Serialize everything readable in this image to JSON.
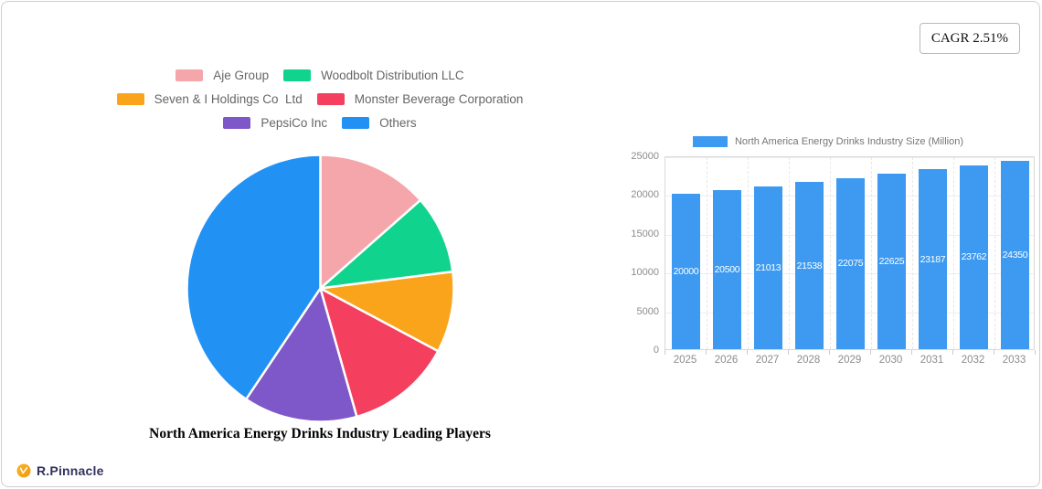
{
  "header": {
    "cagr_badge": "CAGR 2.51%"
  },
  "footer": {
    "logo_text": "R.Pinnacle",
    "logo_icon": "check-circle-icon",
    "logo_icon_color": "#f6a21c",
    "logo_text_color": "#31315e"
  },
  "chart_data": [
    {
      "type": "pie",
      "title": "North America Energy Drinks Industry Leading Players",
      "legend_position": "top",
      "direction": "clockwise",
      "start_angle_deg": 0,
      "slices": [
        {
          "label": "Aje Group",
          "percent": 13.5,
          "color": "#f4a6aa"
        },
        {
          "label": "Woodbolt Distribution LLC",
          "percent": 9.5,
          "color": "#10d48d"
        },
        {
          "label": "Seven & I Holdings Co  Ltd",
          "percent": 9.8,
          "color": "#faa41b"
        },
        {
          "label": "Monster Beverage Corporation",
          "percent": 12.8,
          "color": "#f43f5e"
        },
        {
          "label": "PepsiCo Inc",
          "percent": 13.8,
          "color": "#7e57c9"
        },
        {
          "label": "Others",
          "percent": 40.6,
          "color": "#2191f4"
        }
      ]
    },
    {
      "type": "bar",
      "categories": [
        "2025",
        "2026",
        "2027",
        "2028",
        "2029",
        "2030",
        "2031",
        "2032",
        "2033"
      ],
      "series": [
        {
          "name": "North America Energy Drinks Industry Size (Million)",
          "values": [
            20000,
            20500,
            21013,
            21538,
            22075,
            22625,
            23187,
            23762,
            24350
          ],
          "color": "#3d9af0"
        }
      ],
      "ylim": [
        0,
        25000
      ],
      "yticks": [
        0,
        5000,
        10000,
        15000,
        20000,
        25000
      ],
      "grid": true,
      "legend_position": "top",
      "value_labels": "inside-center-white"
    }
  ]
}
